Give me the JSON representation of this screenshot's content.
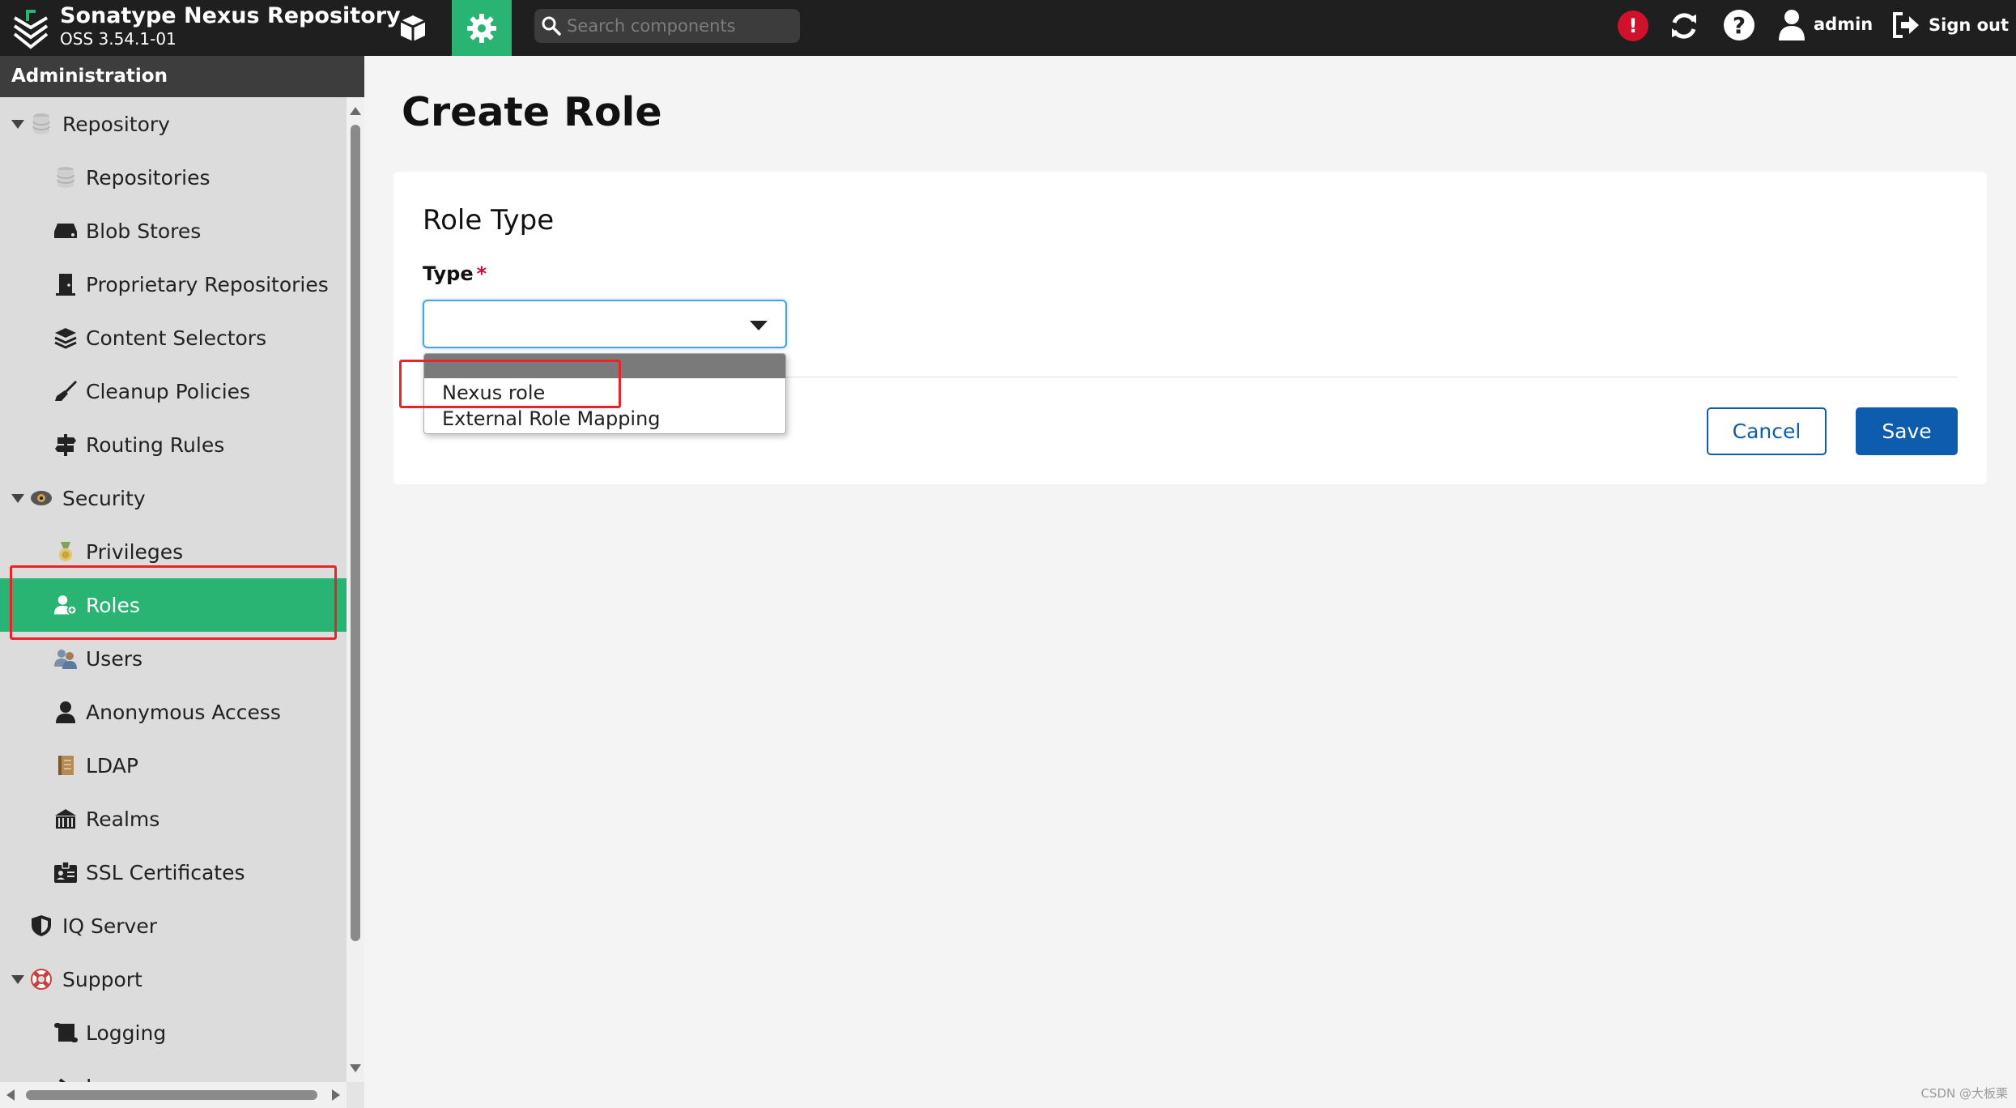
{
  "header": {
    "brand_title": "Sonatype Nexus Repository",
    "brand_version": "OSS 3.54.1-01",
    "search_placeholder": "Search components",
    "user_label": "admin",
    "signout_label": "Sign out",
    "alert_glyph": "!",
    "help_glyph": "?",
    "accent_color": "#29b473"
  },
  "sidebar": {
    "header": "Administration",
    "items": [
      {
        "label": "Repository",
        "icon": "database-icon",
        "level": 0,
        "expanded": true
      },
      {
        "label": "Repositories",
        "icon": "database-icon",
        "level": 1
      },
      {
        "label": "Blob Stores",
        "icon": "hard-drive-icon",
        "level": 1
      },
      {
        "label": "Proprietary Repositories",
        "icon": "door-icon",
        "level": 1
      },
      {
        "label": "Content Selectors",
        "icon": "layers-icon",
        "level": 1
      },
      {
        "label": "Cleanup Policies",
        "icon": "broom-icon",
        "level": 1
      },
      {
        "label": "Routing Rules",
        "icon": "signpost-icon",
        "level": 1
      },
      {
        "label": "Security",
        "icon": "eye-badge-icon",
        "level": 0,
        "expanded": true
      },
      {
        "label": "Privileges",
        "icon": "medal-icon",
        "level": 1
      },
      {
        "label": "Roles",
        "icon": "user-role-icon",
        "level": 1,
        "selected": true
      },
      {
        "label": "Users",
        "icon": "users-icon",
        "level": 1
      },
      {
        "label": "Anonymous Access",
        "icon": "user-icon",
        "level": 1
      },
      {
        "label": "LDAP",
        "icon": "book-icon",
        "level": 1
      },
      {
        "label": "Realms",
        "icon": "building-icon",
        "level": 1
      },
      {
        "label": "SSL Certificates",
        "icon": "certificate-icon",
        "level": 1
      },
      {
        "label": "IQ Server",
        "icon": "shield-icon",
        "level": 0
      },
      {
        "label": "Support",
        "icon": "lifebuoy-icon",
        "level": 0,
        "expanded": true
      },
      {
        "label": "Logging",
        "icon": "scroll-icon",
        "level": 1
      },
      {
        "label": "Logs",
        "icon": "chevron-right-icon",
        "level": 1
      }
    ]
  },
  "main": {
    "page_title": "Create Role",
    "section_title": "Role Type",
    "type_label": "Type",
    "required_marker": "*",
    "type_value": "",
    "dropdown_options": [
      "Nexus role",
      "External Role Mapping"
    ],
    "cancel_label": "Cancel",
    "save_label": "Save"
  },
  "watermark": "CSDN @大板栗"
}
